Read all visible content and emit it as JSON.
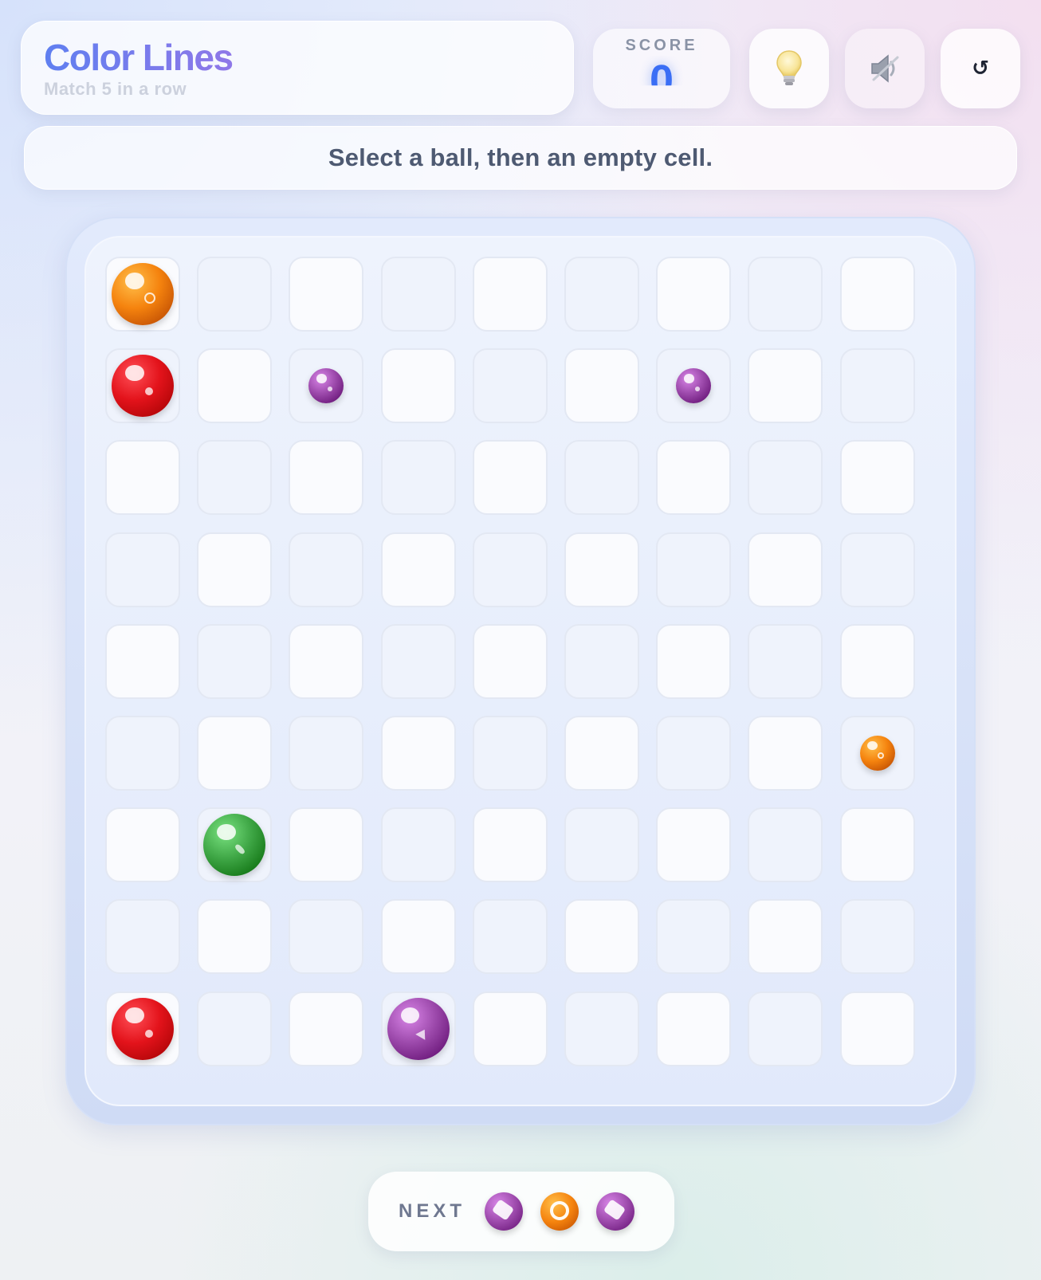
{
  "header": {
    "title": "Color Lines",
    "subtitle": "Match 5 in a row"
  },
  "score": {
    "label": "SCORE",
    "value": "0"
  },
  "buttons": {
    "hint_icon": "lightbulb-icon",
    "sound_icon": "speaker-muted-icon",
    "restart_icon": "restart-icon",
    "restart_glyph": "↺"
  },
  "status": {
    "message": "Select a ball, then an empty cell."
  },
  "colors": {
    "orange": "#f5830e",
    "red": "#e3131b",
    "purple": "#9c49ab",
    "green": "#3ea645",
    "accent_blue": "#3a6ef5"
  },
  "board": {
    "rows": 9,
    "cols": 9,
    "balls": [
      {
        "row": 0,
        "col": 0,
        "color": "orange",
        "size": "big",
        "mark": "ring"
      },
      {
        "row": 1,
        "col": 0,
        "color": "red",
        "size": "big",
        "mark": "dot"
      },
      {
        "row": 1,
        "col": 2,
        "color": "purple",
        "size": "small",
        "mark": "dot"
      },
      {
        "row": 1,
        "col": 6,
        "color": "purple",
        "size": "small",
        "mark": "dot"
      },
      {
        "row": 5,
        "col": 8,
        "color": "orange",
        "size": "small",
        "mark": "ring"
      },
      {
        "row": 6,
        "col": 1,
        "color": "green",
        "size": "big",
        "mark": "dash"
      },
      {
        "row": 8,
        "col": 0,
        "color": "red",
        "size": "big",
        "mark": "dot"
      },
      {
        "row": 8,
        "col": 3,
        "color": "purple",
        "size": "big",
        "mark": "tri"
      }
    ]
  },
  "next": {
    "label": "NEXT",
    "balls": [
      {
        "color": "purple",
        "mark": "diamond"
      },
      {
        "color": "orange",
        "mark": "ring"
      },
      {
        "color": "purple",
        "mark": "diamond"
      }
    ]
  }
}
